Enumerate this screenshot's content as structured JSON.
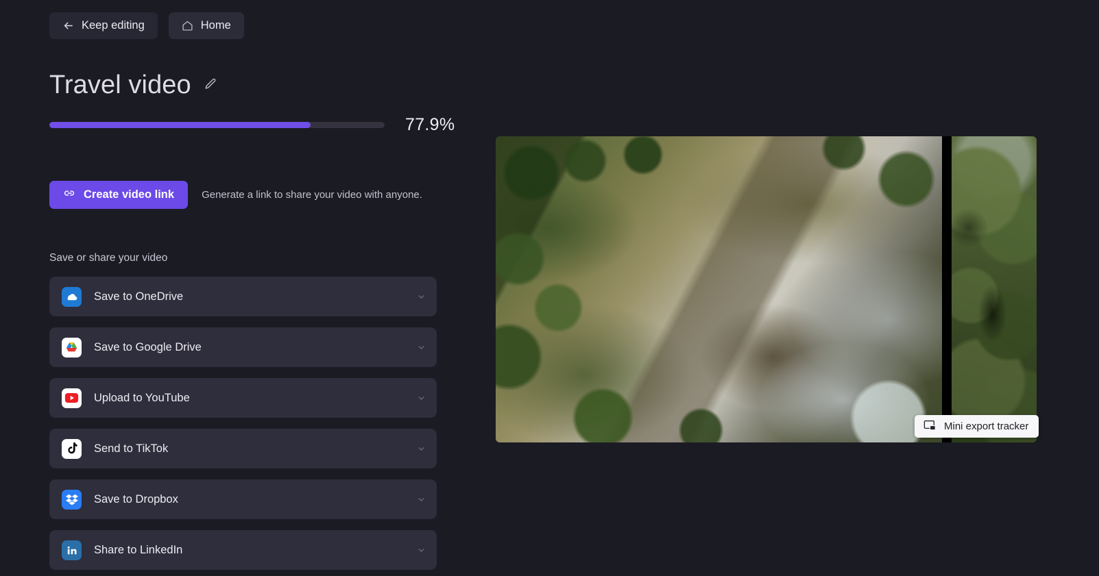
{
  "topbar": {
    "keep_editing_label": "Keep editing",
    "home_label": "Home"
  },
  "project": {
    "title": "Travel video",
    "progress_percent_label": "77.9%",
    "progress_percent_value": 77.9
  },
  "share_link": {
    "button_label": "Create video link",
    "hint": "Generate a link to share your video with anyone."
  },
  "share_section": {
    "label": "Save or share your video",
    "items": [
      {
        "label": "Save to OneDrive",
        "icon": "onedrive-icon"
      },
      {
        "label": "Save to Google Drive",
        "icon": "google-drive-icon"
      },
      {
        "label": "Upload to YouTube",
        "icon": "youtube-icon"
      },
      {
        "label": "Send to TikTok",
        "icon": "tiktok-icon"
      },
      {
        "label": "Save to Dropbox",
        "icon": "dropbox-icon"
      },
      {
        "label": "Share to LinkedIn",
        "icon": "linkedin-icon"
      }
    ]
  },
  "tracker": {
    "label": "Mini export tracker",
    "icon": "picture-in-picture-icon"
  },
  "colors": {
    "page_background": "#1b1b24",
    "row_background": "#2e2e3c",
    "accent_purple": "#6b4ae8",
    "progress_track": "#35323f",
    "text_primary": "#eeecf3"
  }
}
